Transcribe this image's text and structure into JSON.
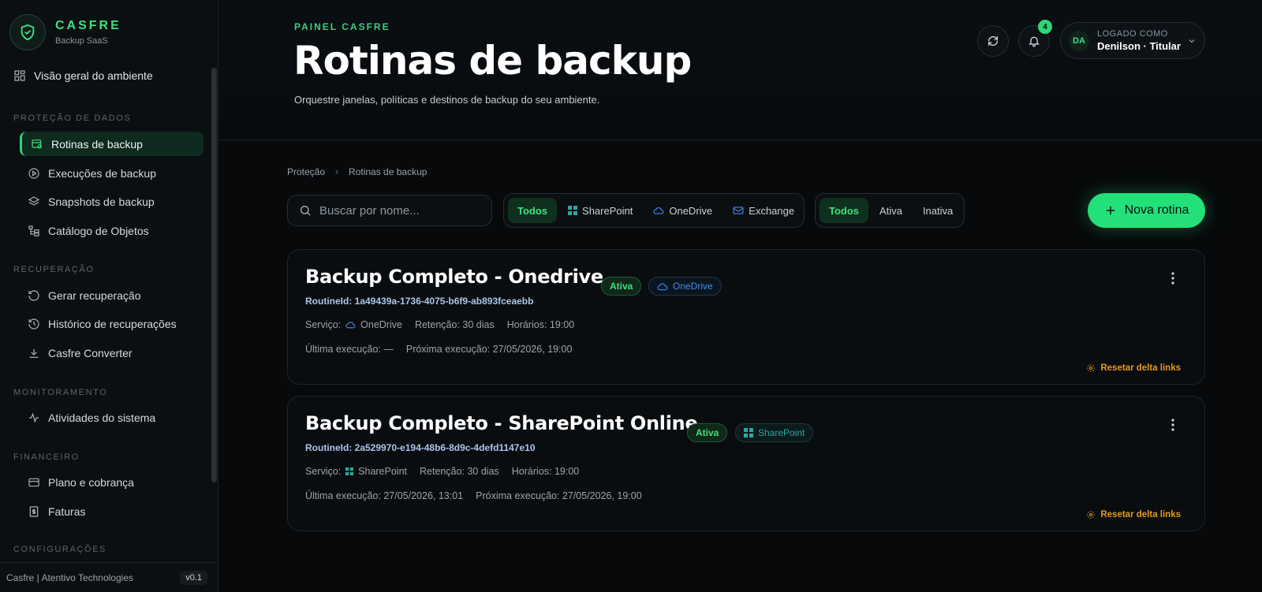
{
  "brand": {
    "name": "CASFRE",
    "subtitle": "Backup SaaS"
  },
  "sidebar": {
    "overview_label": "Visão geral do ambiente",
    "sections": [
      {
        "title": "PROTEÇÃO DE DADOS",
        "items": [
          "Rotinas de backup",
          "Execuções de backup",
          "Snapshots de backup",
          "Catálogo de Objetos"
        ]
      },
      {
        "title": "RECUPERAÇÃO",
        "items": [
          "Gerar recuperação",
          "Histórico de recuperações",
          "Casfre Converter"
        ]
      },
      {
        "title": "MONITORAMENTO",
        "items": [
          "Atividades do sistema"
        ]
      },
      {
        "title": "FINANCEIRO",
        "items": [
          "Plano e cobrança",
          "Faturas"
        ]
      },
      {
        "title": "CONFIGURAÇÕES",
        "items": []
      }
    ],
    "active_item": "Rotinas de backup",
    "footer": {
      "company": "Casfre | Atentivo Technologies",
      "version": "v0.1"
    }
  },
  "header": {
    "kicker": "PAINEL CASFRE",
    "title": "Rotinas de backup",
    "description": "Orquestre janelas, políticas e destinos de backup do seu ambiente.",
    "notifications_count": "4",
    "user": {
      "initials": "DA",
      "label": "LOGADO COMO",
      "name": "Denilson · Titular"
    }
  },
  "breadcrumb": [
    "Proteção",
    "Rotinas de backup"
  ],
  "search": {
    "placeholder": "Buscar por nome..."
  },
  "service_filter": {
    "options": [
      "Todos",
      "SharePoint",
      "OneDrive",
      "Exchange"
    ],
    "selected": "Todos"
  },
  "status_filter": {
    "options": [
      "Todos",
      "Ativa",
      "Inativa"
    ],
    "selected": "Todos"
  },
  "new_button": "Nova rotina",
  "routines": [
    {
      "title": "Backup Completo - Onedrive",
      "status": "Ativa",
      "service": "OneDrive",
      "routine_id": "RoutineId: 1a49439a-1736-4075-b6f9-ab893fceaebb",
      "service_label": "Serviço:",
      "retention": "Retenção: 30 dias",
      "schedule": "Horários: 19:00",
      "last_run": "Última execução: —",
      "next_run": "Próxima execução: 27/05/2026, 19:00",
      "reset_label": "Resetar delta links"
    },
    {
      "title": "Backup Completo - SharePoint Online",
      "status": "Ativa",
      "service": "SharePoint",
      "routine_id": "RoutineId: 2a529970-e194-48b6-8d9c-4defd1147e10",
      "service_label": "Serviço:",
      "retention": "Retenção: 30 dias",
      "schedule": "Horários: 19:00",
      "last_run": "Última execução: 27/05/2026, 13:01",
      "next_run": "Próxima execução: 27/05/2026, 19:00",
      "reset_label": "Resetar delta links"
    }
  ],
  "colors": {
    "accent": "#23e07a",
    "warning": "#e29a1a",
    "onedrive": "#3f8ee8",
    "sharepoint": "#2fa7a0"
  }
}
